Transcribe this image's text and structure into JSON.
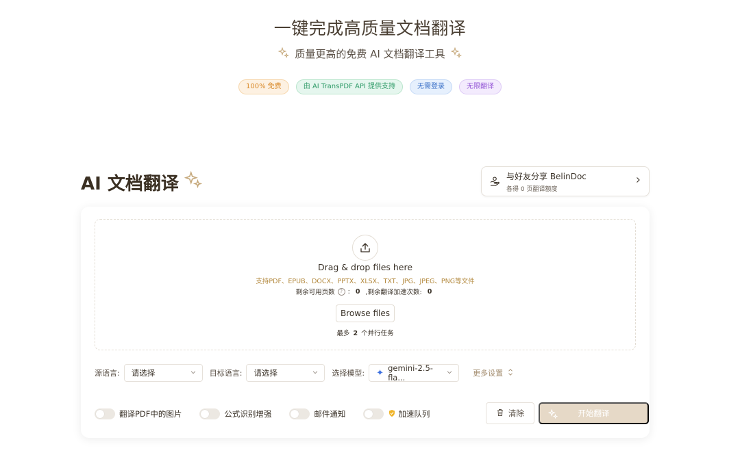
{
  "hero": {
    "title": "一键完成高质量文档翻译",
    "subtitle": "质量更高的免费 AI 文档翻译工具"
  },
  "badges": [
    {
      "label": "100% 免费",
      "color": "#d98a2a"
    },
    {
      "label": "由 AI TransPDF API 提供支持",
      "color": "#2e9a67"
    },
    {
      "label": "无需登录",
      "color": "#3d72c8"
    },
    {
      "label": "无限翻译",
      "color": "#9559d6"
    }
  ],
  "section": {
    "title": "AI 文档翻译"
  },
  "share": {
    "title": "与好友分享 BelinDoc",
    "subtitle": "各得 0 页翻译额度",
    "icon": "gift-hand-icon"
  },
  "dropzone": {
    "title": "Drag & drop files here",
    "formats": "支持PDF、EPUB、DOCX、PPTX、XLSX、TXT、JPG、JPEG、PNG等文件",
    "pages_label": "剩余可用页数",
    "pages_sep": ":",
    "pages_value": "0",
    "accel_label": ",剩余翻译加速次数:",
    "accel_value": "0",
    "browse_label": "Browse files",
    "parallel_prefix": "最多",
    "parallel_value": "2",
    "parallel_suffix": "个并行任务"
  },
  "languages": {
    "source_label": "源语言:",
    "source_value": "请选择",
    "target_label": "目标语言:",
    "target_value": "请选择",
    "model_label": "选择模型:",
    "model_value": "gemini-2.5-fla...",
    "more_settings": "更多设置"
  },
  "options": [
    {
      "label": "翻译PDF中的图片",
      "on": false
    },
    {
      "label": "公式识别增强",
      "on": false
    },
    {
      "label": "邮件通知",
      "on": false
    },
    {
      "label": "加速队列",
      "on": false
    }
  ],
  "actions": {
    "clear_label": "清除",
    "start_label": "开始翻译"
  },
  "colors": {
    "accent": "#c6a97c",
    "start_button": "#e6d9c7",
    "formats_text": "#b3893e"
  }
}
